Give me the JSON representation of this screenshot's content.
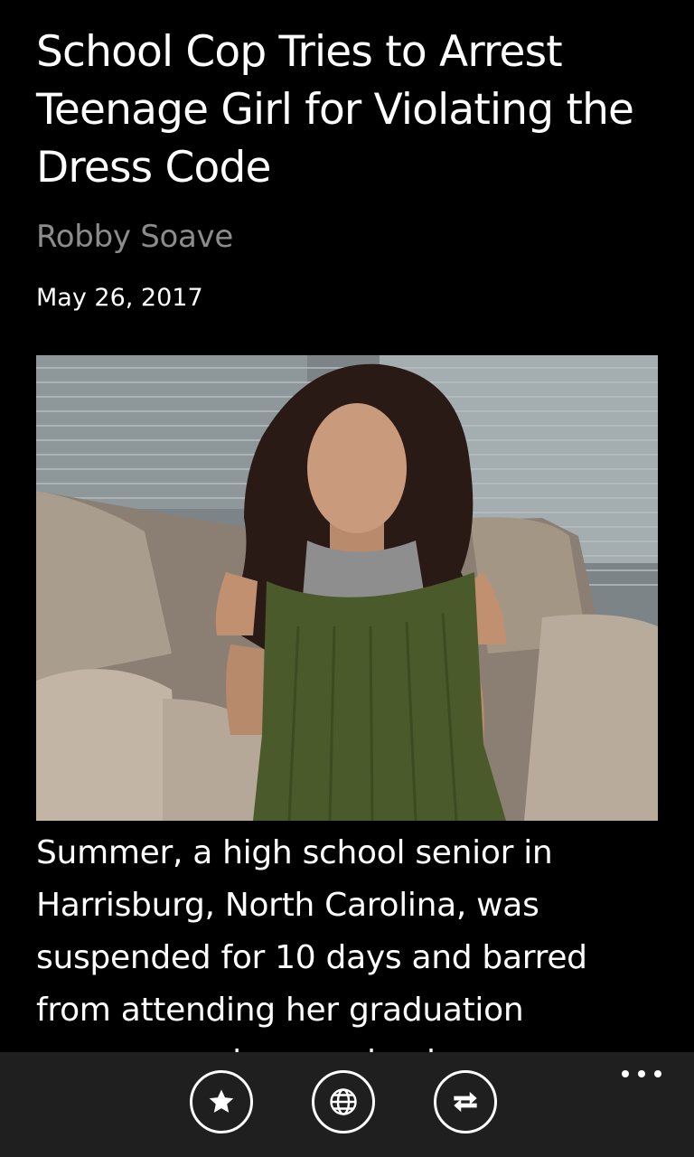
{
  "article": {
    "title": "School Cop Tries to Arrest Teenage Girl for Violating the Dress Code",
    "author": "Robby Soave",
    "date": "May 26, 2017",
    "body": "Summer, a high school senior in Harrisburg, North Carolina, was suspended for 10 days and barred from attending her graduation ceremony when a school..."
  },
  "appbar": {
    "buttons": [
      {
        "icon": "star-icon",
        "action": "favorite"
      },
      {
        "icon": "globe-icon",
        "action": "open-in-browser"
      },
      {
        "icon": "refresh-icon",
        "action": "refresh"
      }
    ],
    "more_icon": "more-options-icon"
  },
  "colors": {
    "background": "#000000",
    "author_text": "#8c8c8c",
    "appbar_background": "#1f1f1f"
  }
}
